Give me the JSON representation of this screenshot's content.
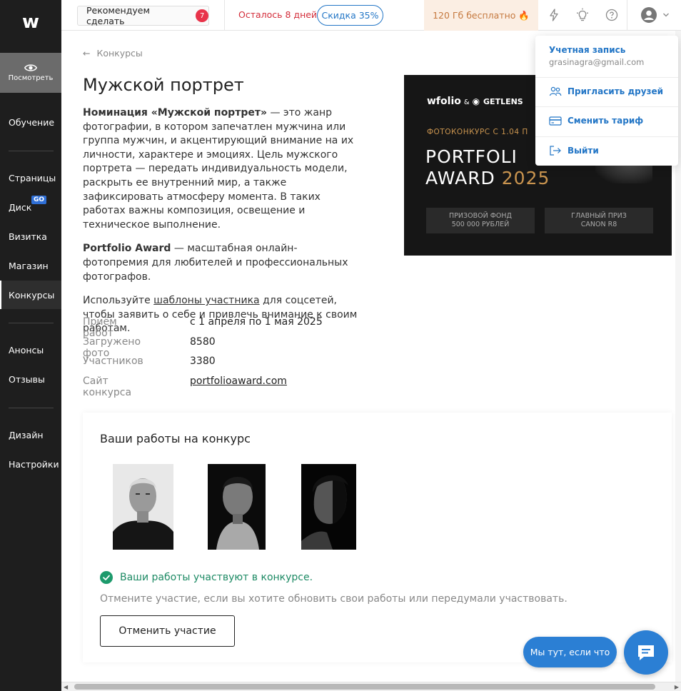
{
  "sidebar": {
    "logo": "w",
    "preview_label": "Посмотреть",
    "items": [
      {
        "label": "Обучение"
      },
      {
        "label": "Страницы"
      },
      {
        "label": "Диск",
        "badge": "GO"
      },
      {
        "label": "Визитка"
      },
      {
        "label": "Магазин"
      },
      {
        "label": "Конкурсы"
      },
      {
        "label": "Анонсы"
      },
      {
        "label": "Отзывы"
      },
      {
        "label": "Дизайн"
      },
      {
        "label": "Настройки"
      }
    ]
  },
  "topbar": {
    "recommend_label": "Рекомендуем сделать",
    "recommend_count": "7",
    "days_left": "Осталось 8 дней",
    "discount": "Скидка 35%",
    "free_storage": "120 Гб бесплатно 🔥"
  },
  "breadcrumb": "Конкурсы",
  "contest": {
    "title": "Мужской портрет",
    "desc_bold1": "Номинация «Мужской портрет»",
    "desc1": " — это жанр фотографии, в котором запечатлен мужчина или группа мужчин, и акцентирующий внимание на их личности, характере и эмоциях. Цель мужского портрета — передать индивидуальность модели, раскрыть ее внутренний мир, а также зафиксировать атмосферу момента. В таких работах важны композиция, освещение и техническое выполнение.",
    "desc_bold2": "Portfolio Award",
    "desc2": " — масштабная онлайн-фотопремия для любителей и профессиональных фотографов.",
    "desc3_pre": "Используйте ",
    "desc3_link": "шаблоны участника",
    "desc3_post": " для соцсетей, чтобы заявить о себе и привлечь внимание к своим работам.",
    "info": [
      {
        "label": "Приём работ",
        "value": "с 1 апреля по 1 мая 2025"
      },
      {
        "label": "Загружено фото",
        "value": "8580"
      },
      {
        "label": "Участников",
        "value": "3380"
      },
      {
        "label": "Сайт конкурса",
        "value": "portfolioaward.com"
      }
    ]
  },
  "banner": {
    "brand1": "wfolio",
    "amp": "&",
    "brand2": "GETLENS",
    "contest": "ФОТОКОНКУРС С 1.04 П",
    "line1": "PORTFOLI",
    "line2_word": "AWARD",
    "line2_year": "2025",
    "box1_l1": "ПРИЗОВОЙ ФОНД",
    "box1_l2": "500 000 РУБЛЕЙ",
    "box2_l1": "ГЛАВНЫЙ ПРИЗ",
    "box2_l2": "CANON R8"
  },
  "works": {
    "title": "Ваши работы на конкурс",
    "status": "Ваши работы участвуют в конкурсе.",
    "hint": "Отмените участие, если вы хотите обновить свои работы или передумали участвовать.",
    "cancel_label": "Отменить участие"
  },
  "chat": {
    "pill_label": "Мы тут, если что"
  },
  "dropdown": {
    "account_label": "Учетная запись",
    "email": "grasinagra@gmail.com",
    "items": [
      {
        "label": "Пригласить друзей"
      },
      {
        "label": "Сменить тариф"
      },
      {
        "label": "Выйти"
      }
    ]
  },
  "colors": {
    "accent": "#2376c6",
    "sidebar_bg": "#1e1e1e",
    "success": "#1d8a64",
    "danger": "#d32d3a",
    "banner_gold": "#c9944f"
  }
}
